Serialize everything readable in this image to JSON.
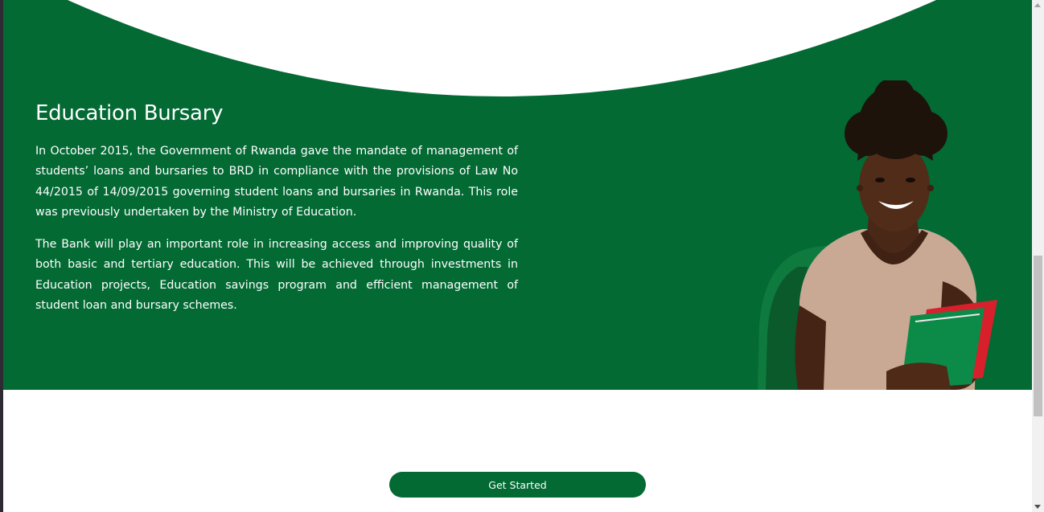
{
  "hero": {
    "title": "Education Bursary",
    "paragraphs": [
      "In October 2015, the Government of Rwanda gave the mandate of management of students’ loans and bursaries to BRD in compliance with the provisions of Law No 44/2015 of 14/09/2015 governing student loans and bursaries in Rwanda. This role was previously undertaken by the Ministry of Education.",
      "The Bank will play an important role in increasing access and improving quality of both basic and tertiary education. This will be achieved through investments in Education projects, Education savings program and efficient management of student loan and bursary schemes."
    ],
    "image_icon": "student-with-backpack-and-folders"
  },
  "cta": {
    "label": "Get Started"
  },
  "colors": {
    "brand_green": "#036a34",
    "white": "#ffffff",
    "scrollbar_track": "#f1f1f1",
    "scrollbar_thumb": "#c1c1c1"
  }
}
